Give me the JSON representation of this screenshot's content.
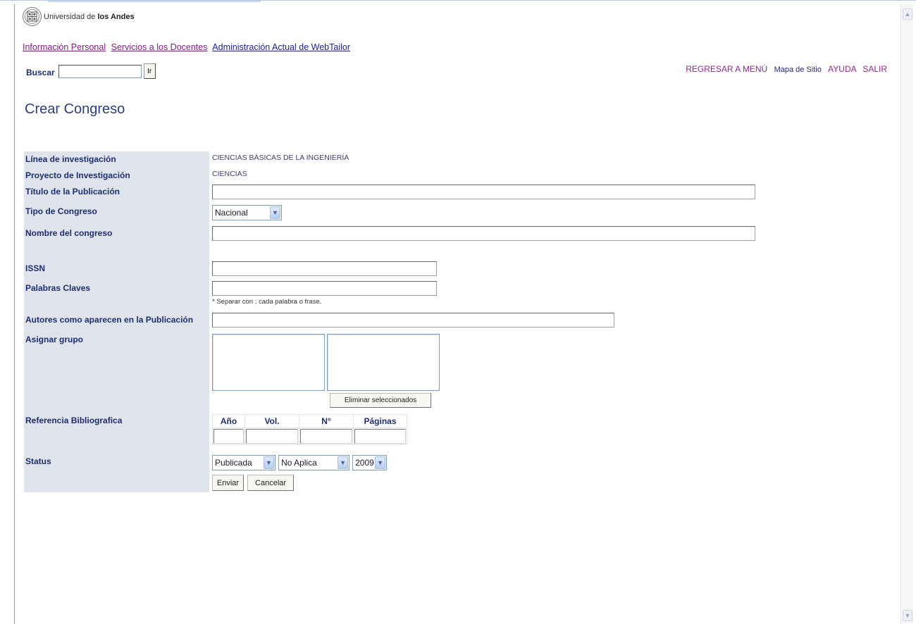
{
  "logo": {
    "prefix": "Universidad de",
    "bold": "los Andes"
  },
  "topnav": {
    "links": [
      "Información Personal",
      "Servicios a los Docentes",
      "Administración Actual de WebTailor"
    ]
  },
  "search": {
    "label": "Buscar",
    "value": "",
    "button": "Ir"
  },
  "rightnav": {
    "back": "REGRESAR A MENÚ",
    "sitemap": "Mapa de Sitio",
    "help": "AYUDA",
    "exit": "SALIR"
  },
  "page": {
    "title": "Crear Congreso"
  },
  "form": {
    "labels": {
      "linea": "Línea de investigación",
      "proyecto": "Proyecto de Investigación",
      "titulo": "Título de la Publicación",
      "tipo": "Tipo de Congreso",
      "nombre": "Nombre del congreso",
      "issn": "ISSN",
      "palabras": "Palabras Claves",
      "autores": "Autores como aparecen en la Publicación",
      "grupo": "Asignar grupo",
      "referencia": "Referencia Bibliografica",
      "status": "Status"
    },
    "values": {
      "linea": "CIENCIAS BÁSICAS DE LA INGENIERÍA",
      "proyecto": "CIENCIAS",
      "titulo": "",
      "nombre": "",
      "issn": "",
      "palabras": "",
      "autores": ""
    },
    "tipo_selected": "Nacional",
    "palabras_note": "* Separar con ; cada palabra o frase.",
    "eliminar_button": "Eliminar seleccionados",
    "referencia_headers": [
      "Año",
      "Vol.",
      "N°",
      "Páginas"
    ],
    "status_selects": [
      "Publicada",
      "No Aplica",
      "2009"
    ],
    "buttons": {
      "submit": "Enviar",
      "cancel": "Cancelar"
    }
  }
}
